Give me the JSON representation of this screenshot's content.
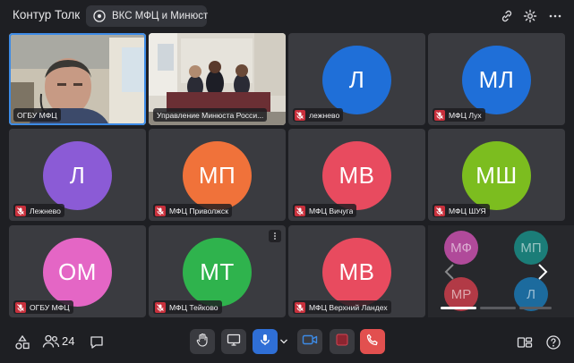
{
  "app": {
    "title": "Контур Толк"
  },
  "meeting": {
    "name": "ВКС МФЦ и Минюст"
  },
  "tiles": [
    {
      "name": "ОГБУ МФЦ",
      "type": "video",
      "muted": false
    },
    {
      "name": "Управление Минюста Росси...",
      "type": "video",
      "muted": false
    },
    {
      "name": "лежнево",
      "initials": "Л",
      "color": "#1f6fd8",
      "muted": true
    },
    {
      "name": "МФЦ Лух",
      "initials": "МЛ",
      "color": "#1f6fd8",
      "muted": true
    },
    {
      "name": "Лежнево",
      "initials": "Л",
      "color": "#8b5bd6",
      "muted": true
    },
    {
      "name": "МФЦ Приволжск",
      "initials": "МП",
      "color": "#f0723a",
      "muted": true
    },
    {
      "name": "МФЦ Вичуга",
      "initials": "МВ",
      "color": "#e84b5f",
      "muted": true
    },
    {
      "name": "МФЦ ШУЯ",
      "initials": "МШ",
      "color": "#7cbd1f",
      "muted": true
    },
    {
      "name": "ОГБУ МФЦ",
      "initials": "ОМ",
      "color": "#e466c5",
      "muted": true
    },
    {
      "name": "МФЦ Тейково",
      "initials": "МТ",
      "color": "#2fb34d",
      "muted": true
    },
    {
      "name": "МФЦ Верхний Ландех",
      "initials": "МВ",
      "color": "#e84b5f",
      "muted": true
    }
  ],
  "overflow": {
    "avatars": [
      {
        "initials": "МФ",
        "color": "#b04a9a"
      },
      {
        "initials": "МП",
        "color": "#1b7d78"
      },
      {
        "initials": "МР",
        "color": "#b23a46"
      },
      {
        "initials": "Л",
        "color": "#1c6b9e"
      }
    ]
  },
  "toolbar": {
    "participants_count": "24"
  },
  "colors": {
    "accent": "#3d8be6",
    "danger": "#e2504f",
    "mic_active": "#2f6fd6",
    "background": "#1e1f23"
  }
}
